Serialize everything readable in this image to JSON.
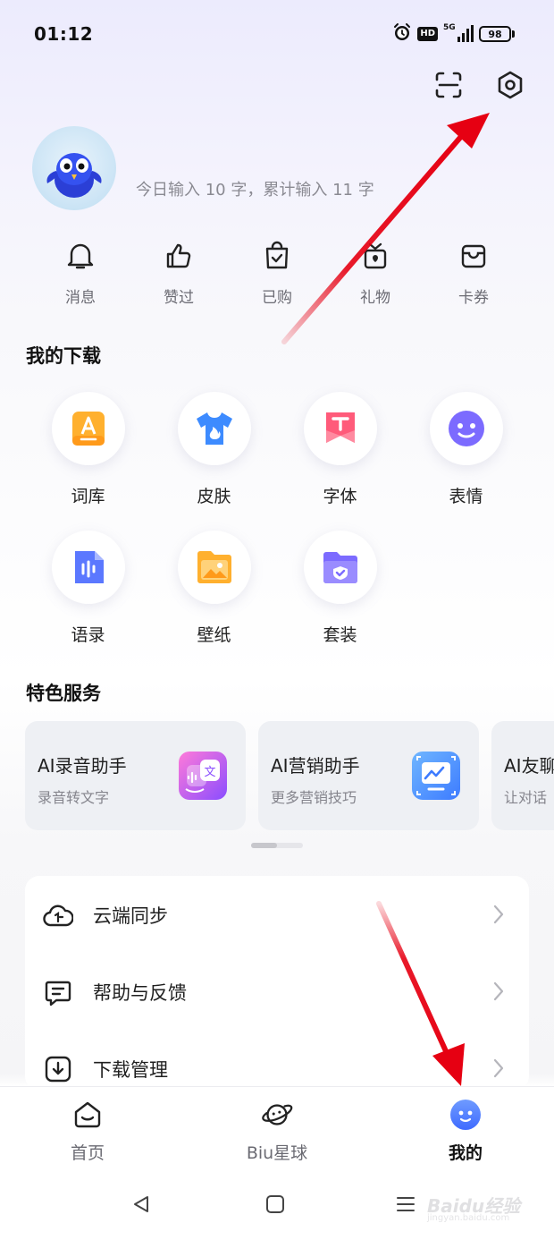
{
  "status_bar": {
    "time": "01:12",
    "hd_badge": "HD",
    "network": "5G",
    "battery": "98"
  },
  "top_actions": {
    "scan_icon": "scan-icon",
    "settings_icon": "settings-hexagon-icon"
  },
  "profile": {
    "stats": "今日输入 10 字，累计输入 11 字"
  },
  "quick_actions": [
    {
      "label": "消息",
      "icon": "bell-icon"
    },
    {
      "label": "赞过",
      "icon": "thumbs-up-icon"
    },
    {
      "label": "已购",
      "icon": "shopping-bag-icon"
    },
    {
      "label": "礼物",
      "icon": "gift-icon"
    },
    {
      "label": "卡券",
      "icon": "coupon-icon"
    }
  ],
  "downloads": {
    "title": "我的下载",
    "items": [
      {
        "label": "词库",
        "icon": "lexicon-icon",
        "color": "#ffb02e"
      },
      {
        "label": "皮肤",
        "icon": "tshirt-icon",
        "color": "#3d8bff"
      },
      {
        "label": "字体",
        "icon": "font-icon",
        "color": "#ff5b7a"
      },
      {
        "label": "表情",
        "icon": "emoji-icon",
        "color": "#7c6bff"
      },
      {
        "label": "语录",
        "icon": "quote-icon",
        "color": "#5b78ff"
      },
      {
        "label": "壁纸",
        "icon": "wallpaper-icon",
        "color": "#ffb02e"
      },
      {
        "label": "套装",
        "icon": "suite-folder-icon",
        "color": "#7c6bff"
      }
    ]
  },
  "services": {
    "title": "特色服务",
    "cards": [
      {
        "title": "AI录音助手",
        "subtitle": "录音转文字",
        "icon": "ai-translate-icon",
        "color": "#b056ff"
      },
      {
        "title": "AI营销助手",
        "subtitle": "更多营销技巧",
        "icon": "ai-chart-screen-icon",
        "color": "#3d8bff"
      },
      {
        "title": "AI友聊",
        "subtitle": "让对话",
        "icon": "ai-chat-icon",
        "color": "#7c6bff"
      }
    ]
  },
  "menu": [
    {
      "label": "云端同步",
      "icon": "cloud-sync-icon"
    },
    {
      "label": "帮助与反馈",
      "icon": "feedback-icon"
    },
    {
      "label": "下载管理",
      "icon": "download-icon"
    }
  ],
  "tabs": [
    {
      "label": "首页",
      "icon": "home-icon",
      "active": false
    },
    {
      "label": "Biu星球",
      "icon": "planet-icon",
      "active": false
    },
    {
      "label": "我的",
      "icon": "mine-avatar-icon",
      "active": true
    }
  ],
  "watermark": {
    "text": "Baidu经验",
    "sub": "jingyan.baidu.com"
  },
  "colors": {
    "annotation_arrow": "#e60012",
    "accent": "#4f7dff"
  }
}
